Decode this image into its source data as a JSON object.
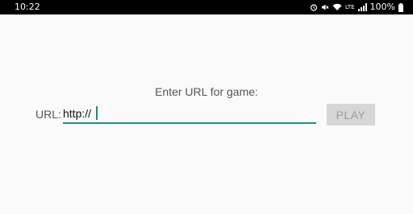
{
  "status_bar": {
    "time": "10:22",
    "battery_percent": "100%",
    "network_label": "LTE",
    "icons": [
      "alarm-icon",
      "mute-icon",
      "wifi-icon",
      "lte-icon",
      "signal-icon",
      "battery-icon"
    ]
  },
  "form": {
    "prompt": "Enter URL for game:",
    "url_label": "URL:",
    "url_value": "http://",
    "play_label": "PLAY",
    "accent_color": "#1e8c7e"
  }
}
